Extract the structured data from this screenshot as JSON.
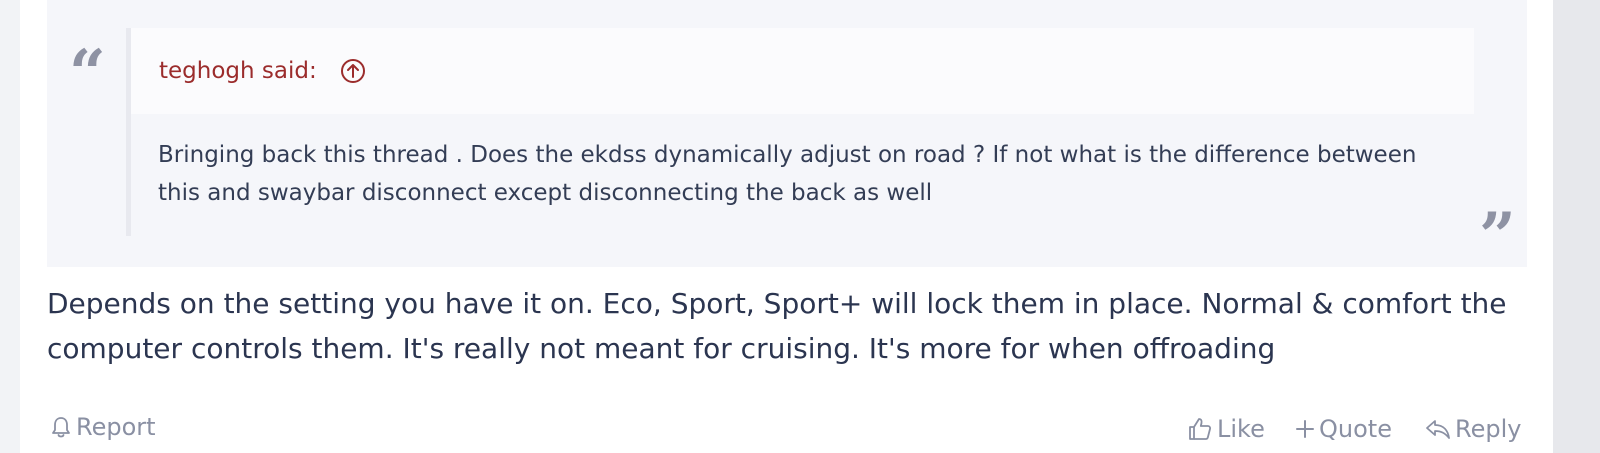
{
  "quote": {
    "author_label": "teghogh said:",
    "text": "Bringing back this thread . Does the ekdss dynamically adjust on road ? If not what is the difference between this and swaybar disconnect except disconnecting the back as well",
    "open_mark": "“",
    "close_mark": "”",
    "goto_icon": "arrow-up-circle-icon"
  },
  "message": {
    "text": "Depends on the setting you have it on. Eco, Sport, Sport+ will lock them in place. Normal & comfort the computer controls them. It's really not meant for cruising. It's more for when offroading"
  },
  "actions": {
    "report": {
      "label": "Report",
      "icon": "bell-icon"
    },
    "like": {
      "label": "Like",
      "icon": "thumbs-up-icon"
    },
    "quote": {
      "label": "Quote",
      "icon": "plus-icon"
    },
    "reply": {
      "label": "Reply",
      "icon": "reply-arrow-icon"
    }
  },
  "colors": {
    "quote_author": "#9b2c2c",
    "body_text": "#2b3550",
    "muted_action": "#8a90a3",
    "quote_background": "#f5f6fa"
  }
}
